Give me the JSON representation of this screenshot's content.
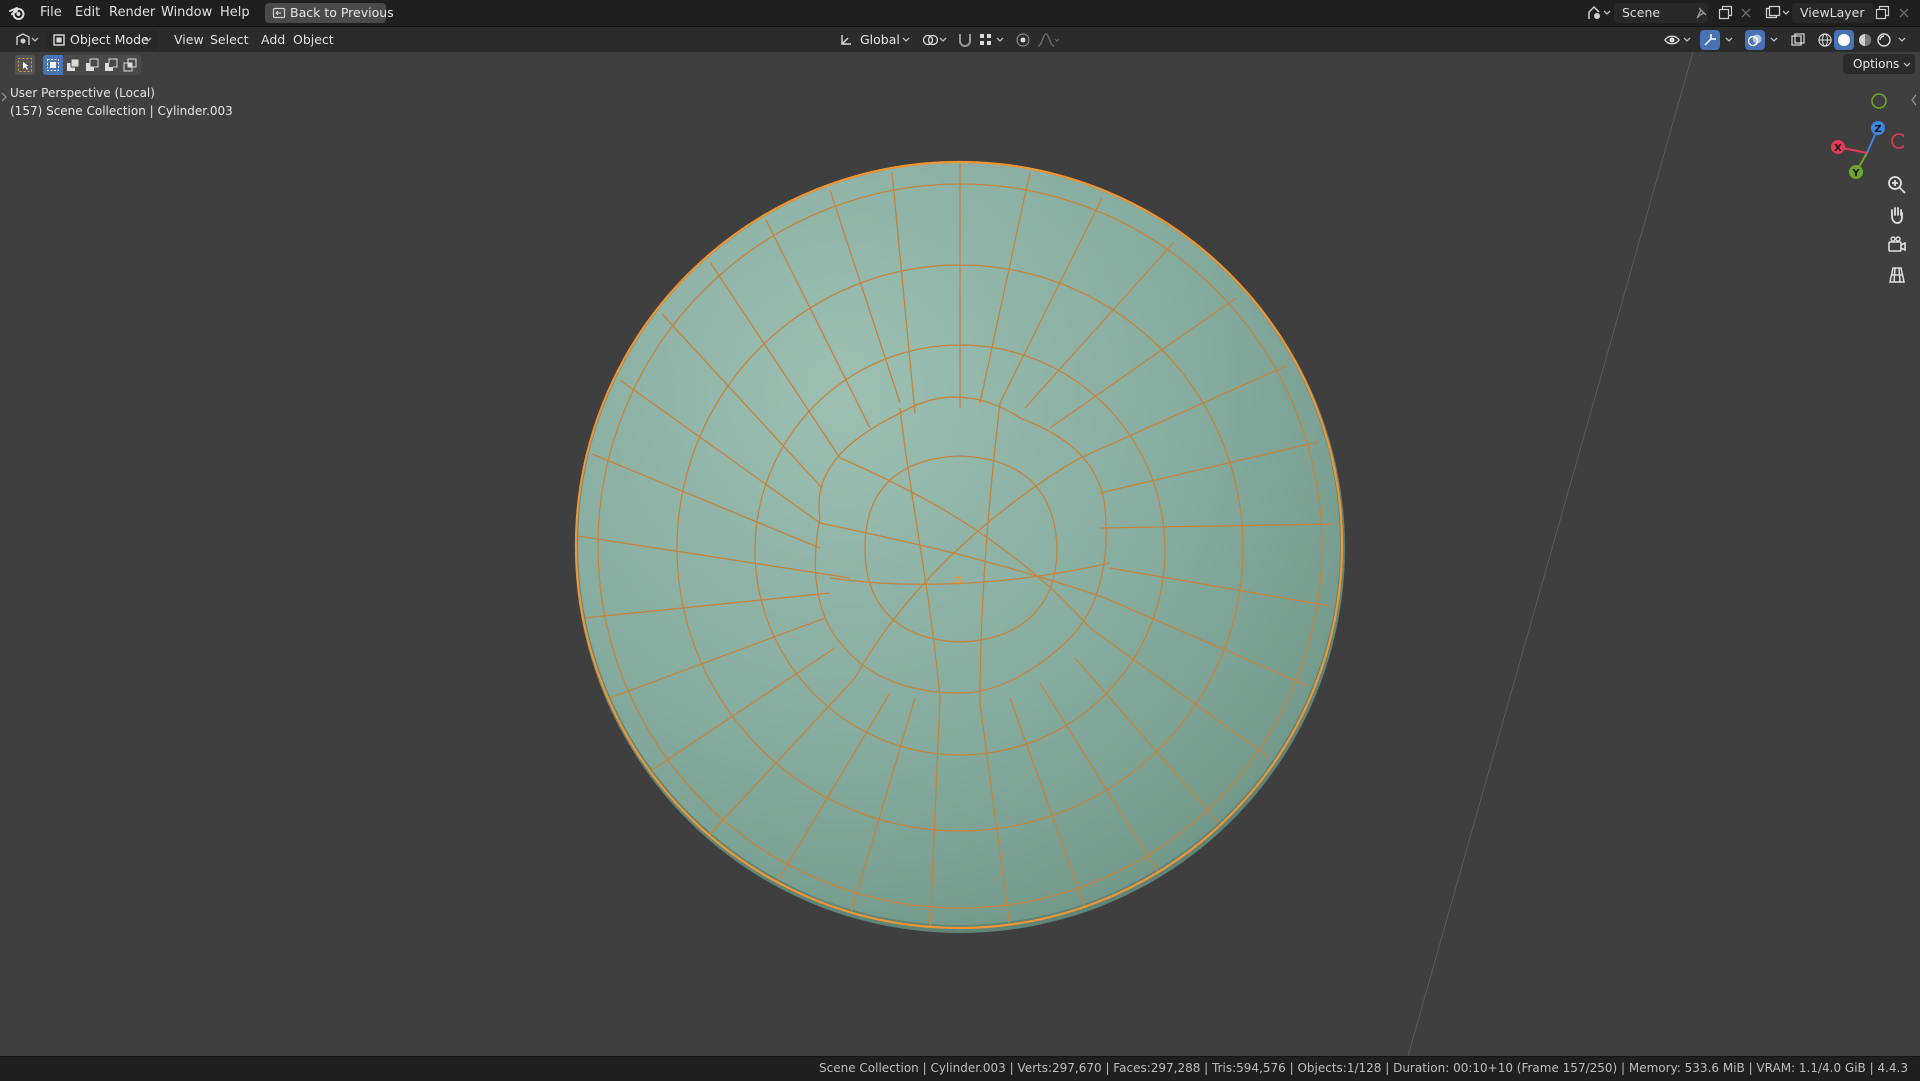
{
  "topbar": {
    "menus": [
      "File",
      "Edit",
      "Render",
      "Window",
      "Help"
    ],
    "back_button": "Back to Previous",
    "scene": "Scene",
    "view_layer": "ViewLayer"
  },
  "header": {
    "mode": "Object Mode",
    "menus": [
      "View",
      "Select",
      "Add",
      "Object"
    ],
    "transform_orientation": "Global",
    "options": "Options"
  },
  "viewport": {
    "view_name": "User Perspective (Local)",
    "collection_info": "(157) Scene Collection | Cylinder.003",
    "gizmo": {
      "x": "X",
      "y": "Y",
      "z": "Z"
    }
  },
  "status": {
    "text": "Scene Collection | Cylinder.003 | Verts:297,670 | Faces:297,288 | Tris:594,576 | Objects:1/128 | Duration: 00:10+10 (Frame 157/250) | Memory: 533.6 MiB | VRAM: 1.1/4.0 GiB | 4.4.3"
  },
  "colors": {
    "accent": "#4772b3",
    "selection_outline": "#f19533",
    "object_surface": "#8cb3a6",
    "axis_x": "#e13b55",
    "axis_y": "#6da52b",
    "axis_z": "#3b86e0"
  },
  "icons": [
    "blender-logo-icon",
    "back-icon",
    "scene-icon",
    "pin-icon",
    "new-scene-icon",
    "close-icon",
    "view-layer-icon",
    "editor-type-icon",
    "object-mode-icon",
    "orientation-icon",
    "pivot-icon",
    "snap-icon",
    "snap-increment-icon",
    "proportional-icon",
    "visibility-icon",
    "gizmo-icon",
    "overlay-icon",
    "xray-icon",
    "wireframe-shading-icon",
    "solid-shading-icon",
    "material-shading-icon",
    "rendered-shading-icon",
    "zoom-icon",
    "hand-pan-icon",
    "camera-icon",
    "grid-icon"
  ]
}
